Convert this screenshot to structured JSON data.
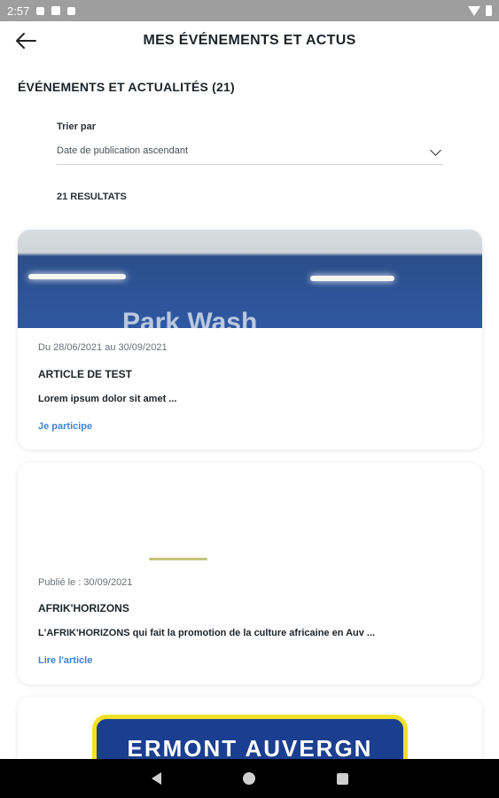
{
  "status_bar": {
    "time": "2:57"
  },
  "header": {
    "title": "MES ÉVÉNEMENTS ET ACTUS"
  },
  "section": {
    "title": "ÉVÉNEMENTS ET ACTUALITÉS (21)"
  },
  "sort": {
    "label": "Trier par",
    "selected": "Date de publication ascendant"
  },
  "results": {
    "count_label": "21 RESULTATS"
  },
  "cards": [
    {
      "date": "Du 28/06/2021 au 30/09/2021",
      "title": "ARTICLE DE TEST",
      "excerpt": "Lorem ipsum dolor sit amet ...",
      "action": "Je participe",
      "image_text": "Park Wash"
    },
    {
      "date": "Publié le : 30/09/2021",
      "title": "AFRIK'HORIZONS",
      "excerpt": "L'AFRIK'HORIZONS qui fait la promotion de la culture africaine en Auv ...",
      "action": "Lire l'article"
    },
    {
      "image_text": "ERMONT AUVERGN"
    }
  ],
  "colors": {
    "link": "#3d86d8",
    "status_bar": "#9e9e9e",
    "nav_bar": "#000000"
  }
}
